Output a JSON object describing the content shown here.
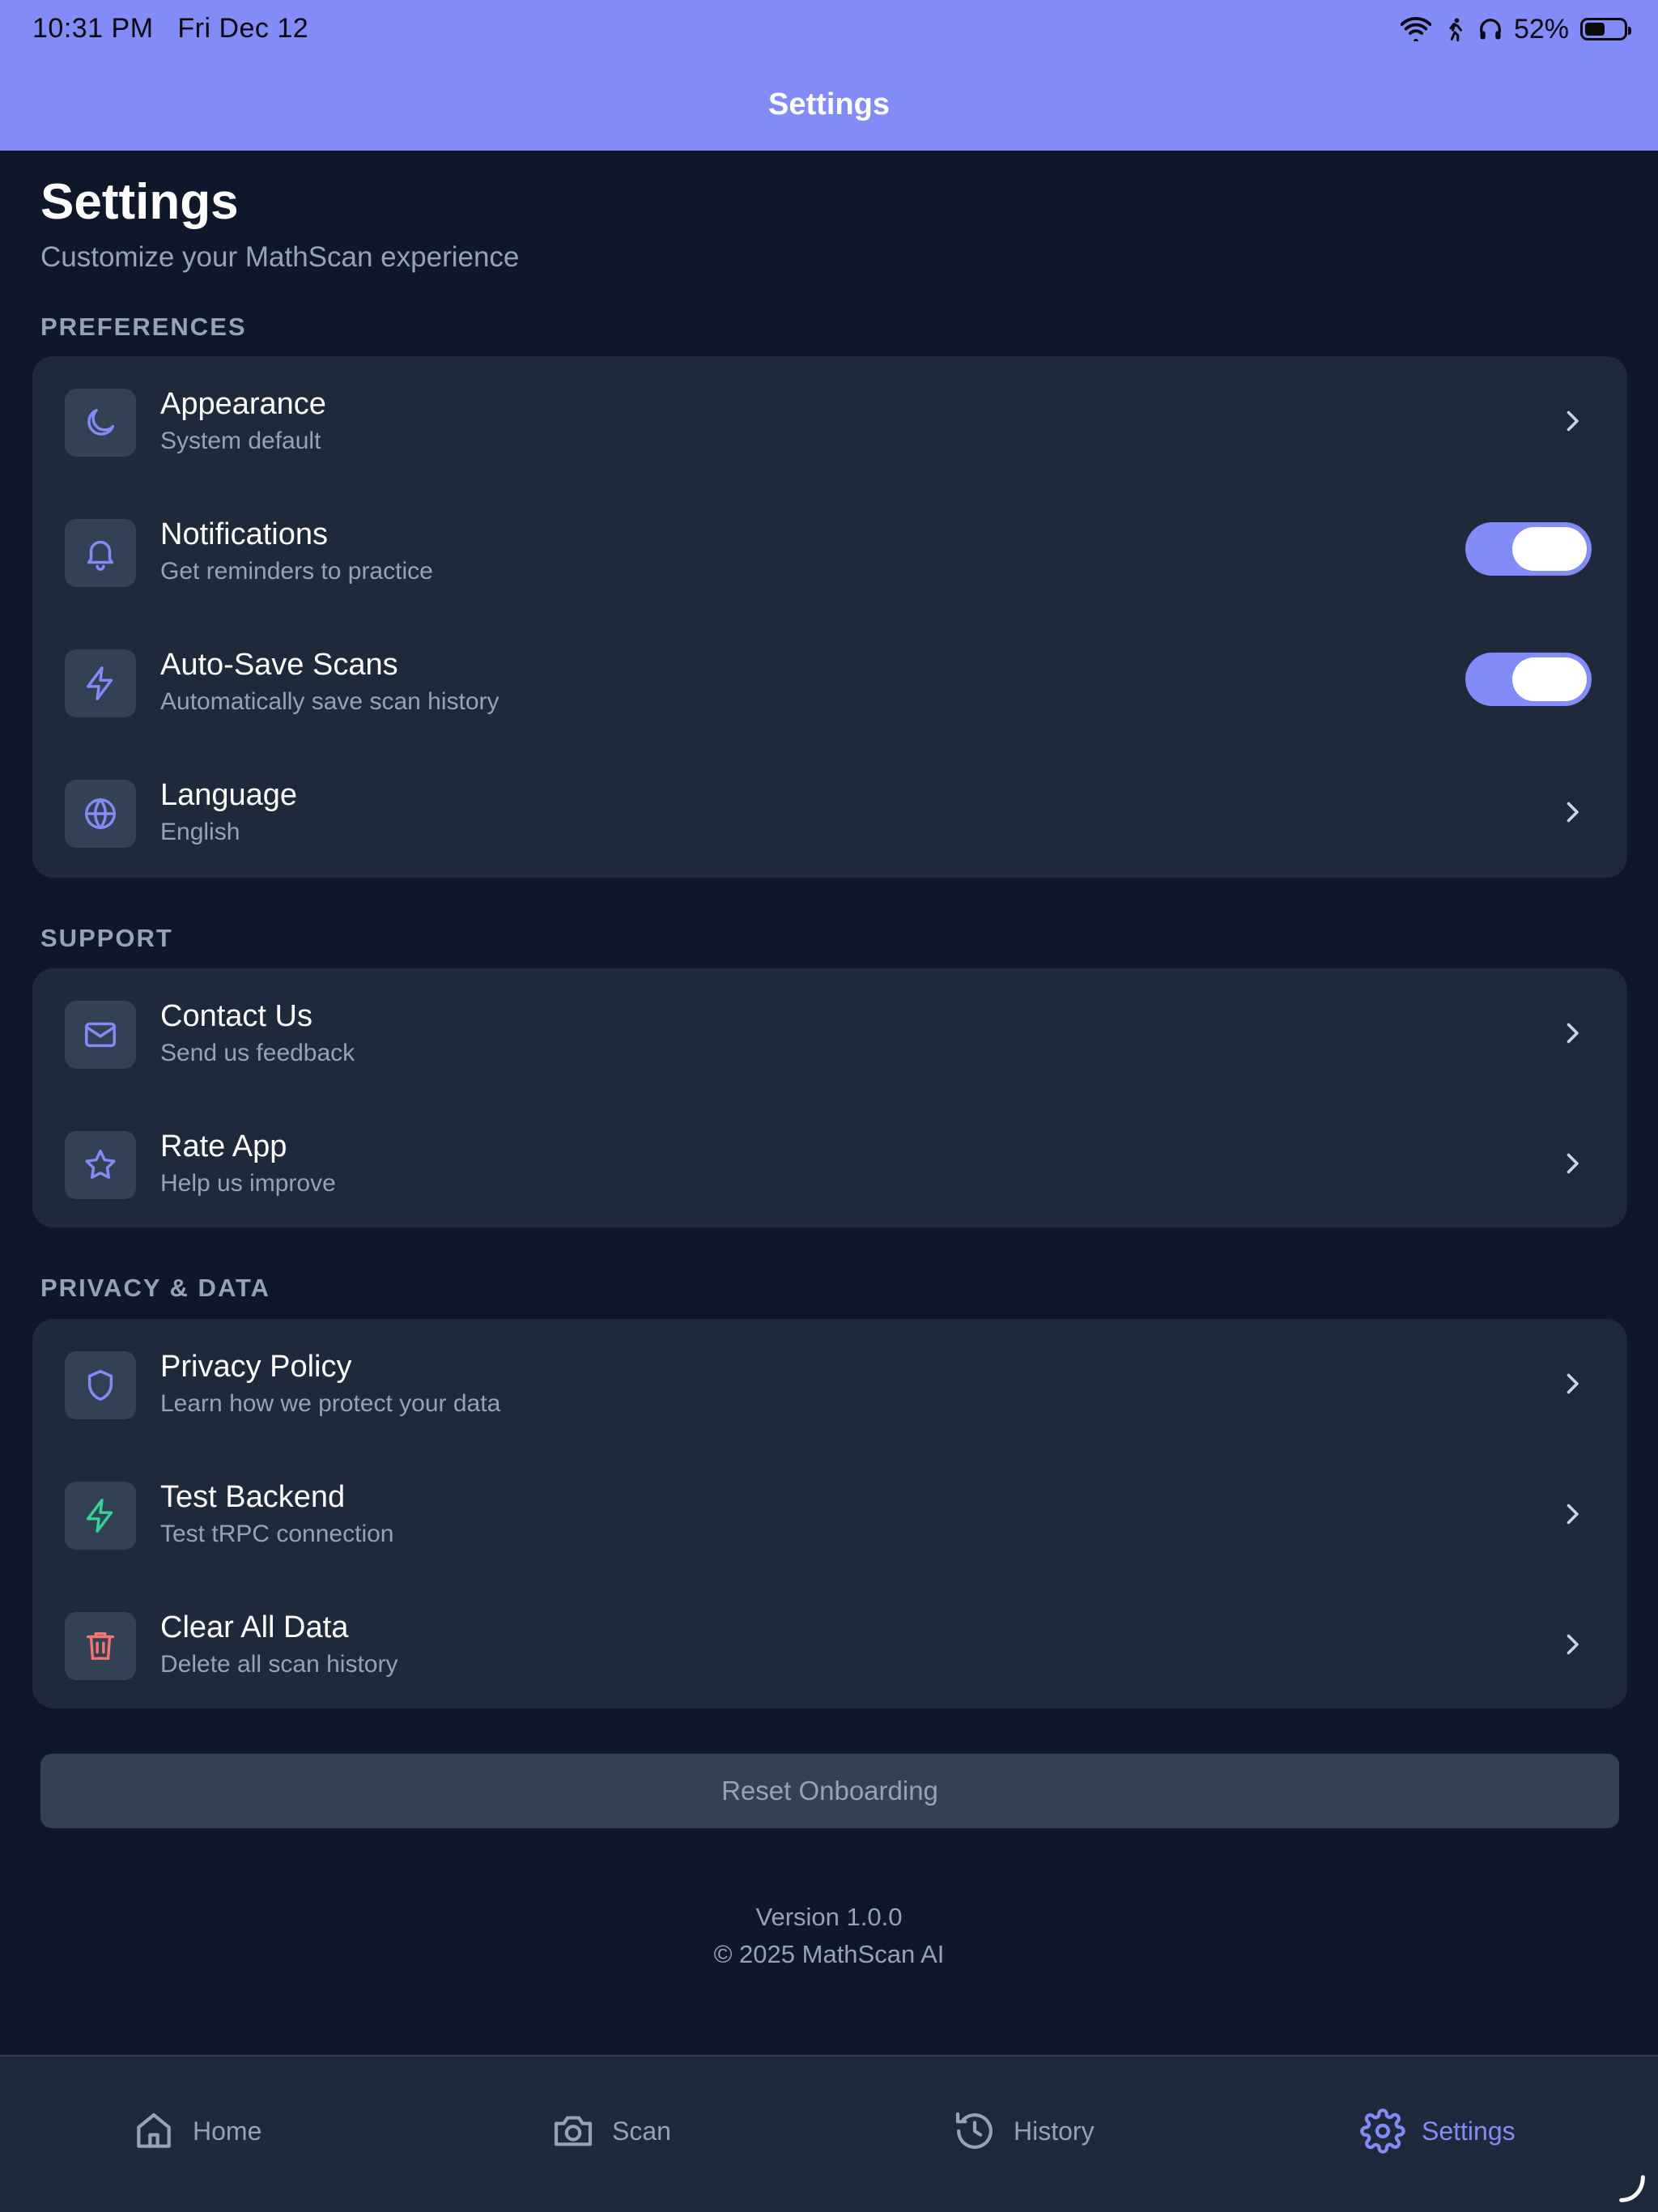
{
  "status_bar": {
    "time": "10:31 PM",
    "date": "Fri Dec 12",
    "battery": "52%",
    "battery_level": 0.52
  },
  "nav": {
    "title": "Settings"
  },
  "header": {
    "title": "Settings",
    "subtitle": "Customize your MathScan experience"
  },
  "sections": {
    "preferences": {
      "label": "PREFERENCES",
      "items": [
        {
          "title": "Appearance",
          "subtitle": "System default",
          "icon": "moon-icon",
          "control": "chevron"
        },
        {
          "title": "Notifications",
          "subtitle": "Get reminders to practice",
          "icon": "bell-icon",
          "control": "toggle",
          "on": true
        },
        {
          "title": "Auto-Save Scans",
          "subtitle": "Automatically save scan history",
          "icon": "lightning-icon",
          "control": "toggle",
          "on": true
        },
        {
          "title": "Language",
          "subtitle": "English",
          "icon": "globe-icon",
          "control": "chevron"
        }
      ]
    },
    "support": {
      "label": "SUPPORT",
      "items": [
        {
          "title": "Contact Us",
          "subtitle": "Send us feedback",
          "icon": "mail-icon",
          "control": "chevron"
        },
        {
          "title": "Rate App",
          "subtitle": "Help us improve",
          "icon": "star-icon",
          "control": "chevron"
        }
      ]
    },
    "privacy": {
      "label": "PRIVACY & DATA",
      "items": [
        {
          "title": "Privacy Policy",
          "subtitle": "Learn how we protect your data",
          "icon": "shield-icon",
          "control": "chevron"
        },
        {
          "title": "Test Backend",
          "subtitle": "Test tRPC connection",
          "icon": "lightning-icon",
          "control": "chevron"
        },
        {
          "title": "Clear All Data",
          "subtitle": "Delete all scan history",
          "icon": "trash-icon",
          "control": "chevron"
        }
      ]
    }
  },
  "reset_button": "Reset Onboarding",
  "footer": {
    "version": "Version 1.0.0",
    "copyright": "© 2025 MathScan AI"
  },
  "tabs": [
    {
      "label": "Home",
      "icon": "home-icon"
    },
    {
      "label": "Scan",
      "icon": "camera-icon"
    },
    {
      "label": "History",
      "icon": "history-icon"
    },
    {
      "label": "Settings",
      "icon": "gear-icon",
      "active": true
    }
  ],
  "colors": {
    "accent": "#818cf8",
    "background": "#0f172a",
    "card": "#1e293b",
    "icon_box": "#334155",
    "muted_text": "#94a3b8",
    "success_icon": "#34d399",
    "danger_icon": "#f87171"
  }
}
